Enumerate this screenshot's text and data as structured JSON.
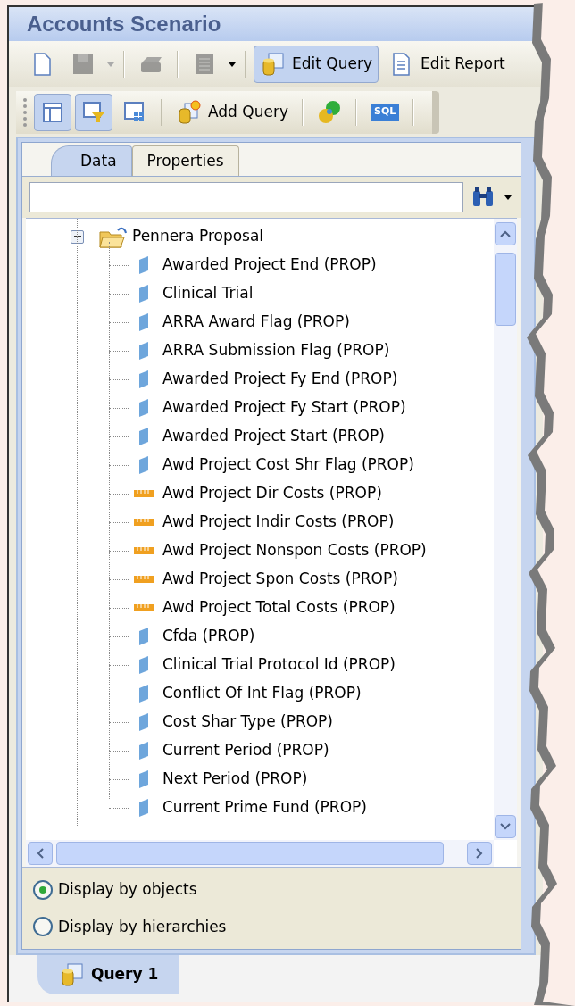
{
  "window": {
    "title": "Accounts Scenario"
  },
  "toolbar": [
    {
      "kind": "icon",
      "disabled": false
    },
    {
      "kind": "icon",
      "disabled": true
    },
    {
      "kind": "caret",
      "disabled": true
    },
    {
      "kind": "sep"
    },
    {
      "kind": "icon",
      "disabled": true
    },
    {
      "kind": "sep"
    },
    {
      "kind": "icon",
      "disabled": true
    },
    {
      "kind": "caret",
      "disabled": false
    },
    {
      "kind": "sep"
    },
    {
      "kind": "text",
      "label": "Edit Query",
      "selected": true
    },
    {
      "kind": "text",
      "label": "Edit Report",
      "selected": false
    }
  ],
  "toolbar2": [
    {
      "kind": "icon",
      "selected": true
    },
    {
      "kind": "icon",
      "selected": true
    },
    {
      "kind": "icon",
      "selected": false
    },
    {
      "kind": "sep"
    },
    {
      "kind": "text",
      "label": "Add Query",
      "selected": false
    },
    {
      "kind": "sep"
    },
    {
      "kind": "icon",
      "selected": false
    },
    {
      "kind": "sep"
    },
    {
      "kind": "icon",
      "label": "SQL",
      "selected": false
    },
    {
      "kind": "sep"
    }
  ],
  "tabs": [
    {
      "label": "Data",
      "selected": true
    },
    {
      "label": "Properties",
      "selected": false
    }
  ],
  "tree": [
    {
      "label": "Pennera Proposal",
      "expanded": true,
      "children": [
        {
          "label": "Awarded Project End (PROP)",
          "kind": "dimension"
        },
        {
          "label": "Clinical Trial",
          "kind": "dimension"
        },
        {
          "label": "ARRA Award Flag (PROP)",
          "kind": "dimension"
        },
        {
          "label": "ARRA Submission Flag (PROP)",
          "kind": "dimension"
        },
        {
          "label": "Awarded Project Fy End (PROP)",
          "kind": "dimension"
        },
        {
          "label": "Awarded Project Fy Start (PROP)",
          "kind": "dimension"
        },
        {
          "label": "Awarded Project Start (PROP)",
          "kind": "dimension"
        },
        {
          "label": "Awd Project Cost Shr Flag (PROP)",
          "kind": "dimension"
        },
        {
          "label": "Awd Project Dir Costs (PROP)",
          "kind": "measure"
        },
        {
          "label": "Awd Project Indir Costs (PROP)",
          "kind": "measure"
        },
        {
          "label": "Awd Project Nonspon Costs (PROP)",
          "kind": "measure"
        },
        {
          "label": "Awd Project Spon Costs (PROP)",
          "kind": "measure"
        },
        {
          "label": "Awd Project Total Costs (PROP)",
          "kind": "measure"
        },
        {
          "label": "Cfda (PROP)",
          "kind": "dimension"
        },
        {
          "label": "Clinical Trial Protocol Id (PROP)",
          "kind": "dimension"
        },
        {
          "label": "Conflict Of Int Flag (PROP)",
          "kind": "dimension"
        },
        {
          "label": "Cost Shar Type (PROP)",
          "kind": "dimension"
        },
        {
          "label": "Current Period (PROP)",
          "kind": "dimension"
        },
        {
          "label": "Next Period (PROP)",
          "kind": "dimension"
        },
        {
          "label": "Current Prime Fund (PROP)",
          "kind": "dimension"
        }
      ]
    }
  ],
  "display_options": [
    {
      "label": "Display by objects",
      "selected": true
    },
    {
      "label": "Display by hierarchies",
      "selected": false
    }
  ],
  "bottom_tabs": [
    {
      "label": "Query 1",
      "selected": true
    }
  ]
}
